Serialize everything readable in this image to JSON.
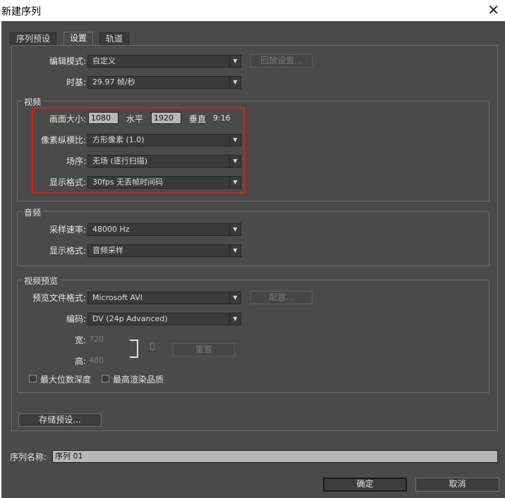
{
  "window": {
    "title": "新建序列",
    "close_glyph": "✕"
  },
  "tabs": [
    {
      "label": "序列预设"
    },
    {
      "label": "设置"
    },
    {
      "label": "轨道"
    }
  ],
  "editing_mode": {
    "label": "编辑模式:",
    "value": "自定义",
    "playback_button": "回放设置..."
  },
  "timebase": {
    "label": "时基:",
    "value": "29.97 帧/秒"
  },
  "video": {
    "title": "视频",
    "frame_size": {
      "label": "画面大小:",
      "horizontal_value": "1080",
      "horizontal_label": "水平",
      "vertical_value": "1920",
      "vertical_label": "垂直",
      "aspect": "9:16"
    },
    "pixel_aspect": {
      "label": "像素纵横比:",
      "value": "方形像素 (1.0)"
    },
    "fields": {
      "label": "场序:",
      "value": "无场 (逐行扫描)"
    },
    "display_format": {
      "label": "显示格式:",
      "value": "30fps 无丢帧时间码"
    }
  },
  "audio": {
    "title": "音频",
    "sample_rate": {
      "label": "采样速率:",
      "value": "48000 Hz"
    },
    "display_format": {
      "label": "显示格式:",
      "value": "音频采样"
    }
  },
  "video_preview": {
    "title": "视频预览",
    "file_format": {
      "label": "预览文件格式:",
      "value": "Microsoft AVI",
      "configure_button": "配置..."
    },
    "codec": {
      "label": "编码:",
      "value": "DV (24p Advanced)"
    },
    "width": {
      "label": "宽:",
      "value": "720"
    },
    "height": {
      "label": "高:",
      "value": "480"
    },
    "reset_button": "重置",
    "max_bit_depth": {
      "label": "最大位数深度"
    },
    "max_render_quality": {
      "label": "最高渲染品质"
    }
  },
  "save_preset_button": "存储预设...",
  "sequence_name": {
    "label": "序列名称:",
    "value": "序列 01"
  },
  "ok_button": "确定",
  "cancel_button": "取消",
  "colors": {
    "dialog_bg": "#4a4a4a",
    "highlight": "#e01a1a"
  }
}
